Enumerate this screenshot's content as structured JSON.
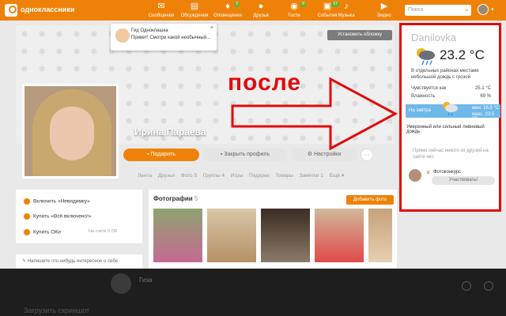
{
  "app": {
    "logo_text": "одноклассники"
  },
  "nav": [
    {
      "label": "Сообщения",
      "icon": "mail-icon",
      "badge": ""
    },
    {
      "label": "Обсуждения",
      "icon": "chat-icon",
      "badge": ""
    },
    {
      "label": "Оповещения",
      "icon": "bell-icon",
      "badge": "2"
    },
    {
      "label": "Друзья",
      "icon": "friends-icon",
      "badge": ""
    },
    {
      "label": "Гости",
      "icon": "guests-icon",
      "badge": "8"
    },
    {
      "label": "События",
      "icon": "events-icon",
      "badge": "67"
    },
    {
      "label": "Музыка",
      "icon": "music-icon",
      "badge": ""
    },
    {
      "label": "Видео",
      "icon": "video-icon",
      "badge": ""
    }
  ],
  "search": {
    "placeholder": "Поиск"
  },
  "notification": {
    "title": "Гид Одноклашка",
    "text": "Привет! Смотри какой необычный...",
    "close": "×"
  },
  "cover": {
    "button": "Установить обложку"
  },
  "profile": {
    "name": "Ирина Параева",
    "gift_button": "Подарить",
    "close_profile_button": "Закрыть профиль",
    "settings_button": "Настройки",
    "more_button": "···",
    "tabs": [
      "Лента",
      "Друзья",
      "Фото 5",
      "Группы 4",
      "Игры",
      "Подарки",
      "Товары",
      "Заметки 1",
      "Ещё ▾"
    ]
  },
  "left_panel": {
    "invisible": "Включить «Невидимку»",
    "all_inclusive": "Купить «Всё включено!»",
    "buy_ok": "Купить ОКи",
    "balance": "На счёте 0 ОК",
    "status_placeholder": "Напишите что-нибудь интересное о себе"
  },
  "photos": {
    "title": "Фотографии",
    "count": "5",
    "add_button": "Добавить фото"
  },
  "bottom": {
    "name": "Гиза",
    "screenshot_label": "Загрузить скриншот"
  },
  "annotation": {
    "text": "после",
    "color": "#e20b0b"
  },
  "weather": {
    "city": "Danilovka",
    "temperature": "23.2 °C",
    "description": "В отдельных районах местами небольшой дождь с грозой",
    "feels_like_label": "Чувствуется как",
    "feels_like_value": "25.1 °C",
    "humidity_label": "Влажность",
    "humidity_value": "69 %",
    "forecast_label": "На завтра",
    "forecast_min": "мин. 16.5 °C",
    "forecast_max": "макс. 23.5 °C",
    "forecast_desc": "Умеренный или сильный ливневый дождь",
    "friends_text": "Прямо сейчас никого из друзей на сайте нет.",
    "contest_label": "Фотоконкурс",
    "join_button": "Участвовать!"
  },
  "colors": {
    "brand": "#ee8208",
    "highlight": "#e20b0b",
    "forecast_bg": "#6fb8ea"
  }
}
